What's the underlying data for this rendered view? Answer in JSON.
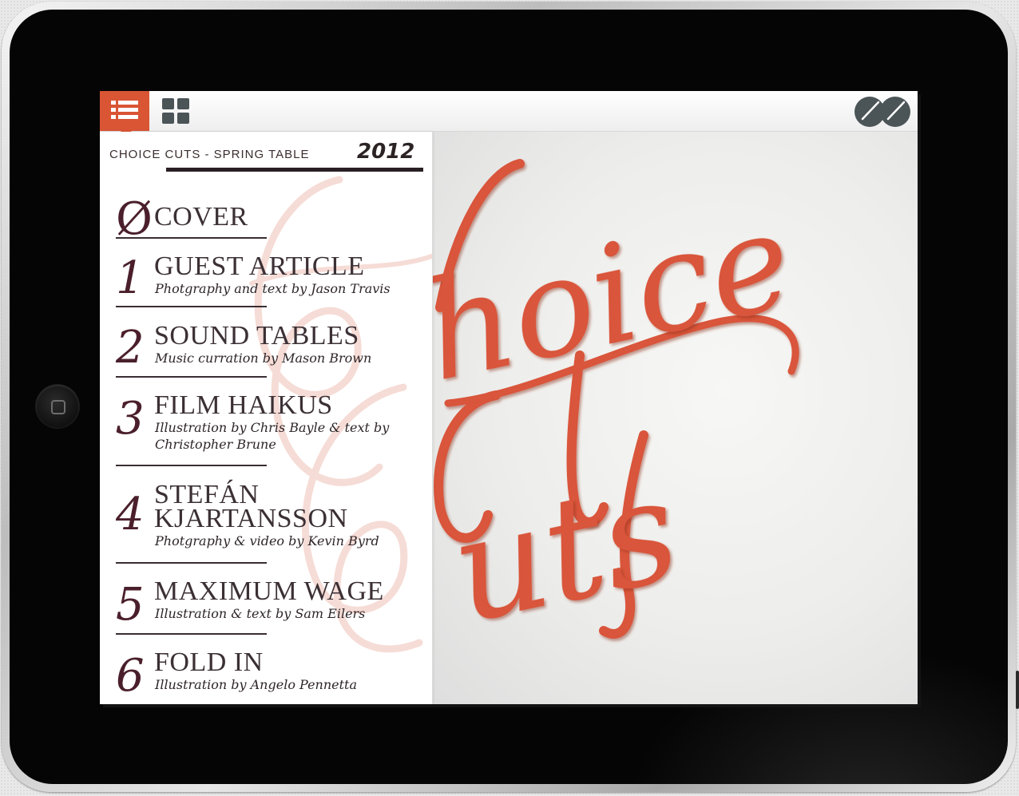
{
  "toolbar": {
    "list_icon": "list-icon",
    "grid_icon": "grid-icon",
    "logo_icon": "logo-icon",
    "accent": "#d95534"
  },
  "issue": {
    "title": "CHOICE CUTS - SPRING TABLE",
    "year": "2012"
  },
  "toc": [
    {
      "number": "Ø",
      "title": "COVER",
      "subtitle": ""
    },
    {
      "number": "1",
      "title": "GUEST ARTICLE",
      "subtitle": "Photgraphy and text by Jason Travis"
    },
    {
      "number": "2",
      "title": "SOUND TABLES",
      "subtitle": "Music curration by Mason Brown"
    },
    {
      "number": "3",
      "title": "FILM HAIKUS",
      "subtitle_line1": "Illustration by Chris Bayle & text by",
      "subtitle_line2": "Christopher Brune"
    },
    {
      "number": "4",
      "title_line1": "STEFÁN",
      "title_line2": "KJARTANSSON",
      "subtitle": "Photgraphy & video by Kevin Byrd"
    },
    {
      "number": "5",
      "title": "MAXIMUM WAGE",
      "subtitle": "Illustration & text by Sam Eilers"
    },
    {
      "number": "6",
      "title": "FOLD IN",
      "subtitle": "Illustration by Angelo Pennetta"
    }
  ],
  "cover": {
    "line1": "hoice",
    "line2": "uts",
    "script_color": "#d9553a"
  }
}
